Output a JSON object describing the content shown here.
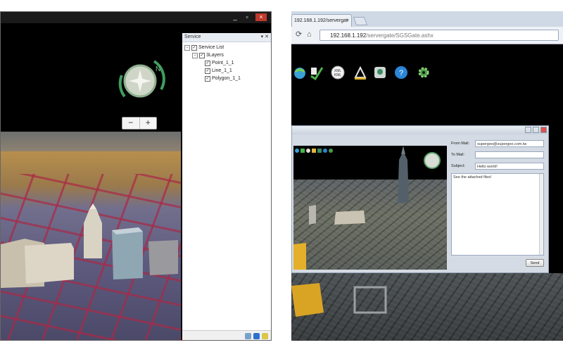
{
  "left_window": {
    "title_buttons": [
      "_",
      "▫",
      "×"
    ],
    "zoom": {
      "minus": "−",
      "plus": "+"
    },
    "compass_letter": "N",
    "service_panel": {
      "header": "Service",
      "tree": {
        "root": "Service List",
        "group": "3Layers",
        "layers": [
          "Point_1_1",
          "Line_1_1",
          "Polygon_1_1"
        ]
      }
    }
  },
  "right_window": {
    "tab": {
      "label": "192.168.1.192/servergat",
      "close": "×"
    },
    "url": {
      "host": "192.168.1.192",
      "path": "/servergate/SGSGate.ashx"
    },
    "toolbar_icons": [
      "globe-arrow-icon",
      "edit-check-icon",
      "xml-icon",
      "measure-icon",
      "map-marker-icon",
      "help-icon",
      "settings-gear-icon"
    ],
    "xml_label": "XML\nKML",
    "mail_dialog": {
      "from_label": "From Mail:",
      "from_value": "supergeo@supergeo.com.tw",
      "to_label": "To Mail:",
      "to_value": "",
      "subject_label": "Subject:",
      "subject_value": "Hello world!",
      "body": "See the attached files!",
      "send_label": "Send"
    }
  }
}
